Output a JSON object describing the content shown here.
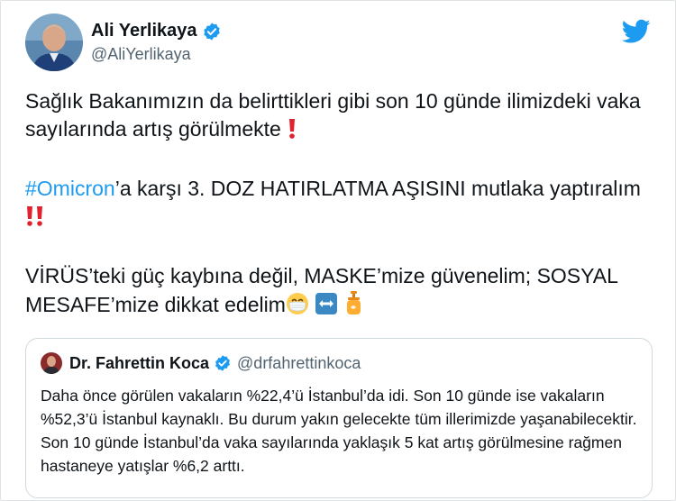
{
  "tweet": {
    "author": {
      "name": "Ali Yerlikaya",
      "handle": "@AliYerlikaya"
    },
    "paragraph1": "Sağlık Bakanımızın da belirttikleri gibi son 10 günde ilimizdeki vaka sayılarında artış görülmekte",
    "paragraph2": {
      "hashtag": "#Omicron",
      "text": "’a karşı 3. DOZ HATIRLATMA AŞISINI mutlaka yaptıralım"
    },
    "paragraph3": "VİRÜS’teki güç kaybına değil, MASKE’mize güvenelim; SOSYAL MESAFE’mize dikkat edelim",
    "icons": [
      "exclamation-icon",
      "double-exclamation-icon",
      "mask-face-emoji",
      "left-right-arrow-emoji",
      "lotion-bottle-emoji"
    ]
  },
  "quoted": {
    "author": {
      "name": "Dr. Fahrettin Koca",
      "handle": "@drfahrettinkoca"
    },
    "text": "Daha önce görülen vakaların %22,4’ü İstanbul’da idi. Son 10 günde ise vakaların %52,3’ü İstanbul kaynaklı. Bu durum yakın gelecekte tüm illerimizde yaşanabilecektir. Son 10 günde İstanbul’da vaka sayılarında yaklaşık 5 kat artış görülmesine rağmen hastaneye yatışlar %6,2 arttı."
  },
  "colors": {
    "accent": "#1d9bf0",
    "exclamation": "#e0222f",
    "text": "#0f1419",
    "muted": "#536471"
  }
}
